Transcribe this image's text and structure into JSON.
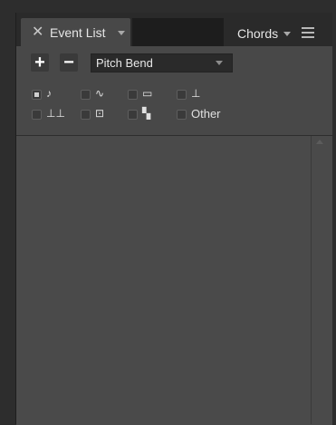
{
  "tabs": {
    "active": {
      "close_glyph": "✕",
      "label": "Event List"
    },
    "secondary": {
      "label": "Chords"
    }
  },
  "toolbar": {
    "add_glyph": "+",
    "remove_glyph": "−",
    "event_type_selected": "Pitch Bend"
  },
  "filters": [
    {
      "icon": "note-icon",
      "glyph": "♪",
      "checked": true
    },
    {
      "icon": "pitch-bend-icon",
      "glyph": "∿",
      "checked": false
    },
    {
      "icon": "program-change-icon",
      "glyph": "▭",
      "checked": false
    },
    {
      "icon": "controller-icon",
      "glyph": "⊥",
      "checked": false
    },
    {
      "icon": "aftertouch-icon",
      "glyph": "⊥⊥",
      "checked": false
    },
    {
      "icon": "sysex-icon",
      "glyph": "⊡",
      "checked": false
    },
    {
      "icon": "meta-event-icon",
      "glyph": "▚",
      "checked": false
    },
    {
      "icon": "other-label",
      "label": "Other",
      "checked": false
    }
  ],
  "colors": {
    "panel_bg": "#484848",
    "tabbar_bg": "#2a2a2a",
    "text": "#e6e6e6"
  }
}
